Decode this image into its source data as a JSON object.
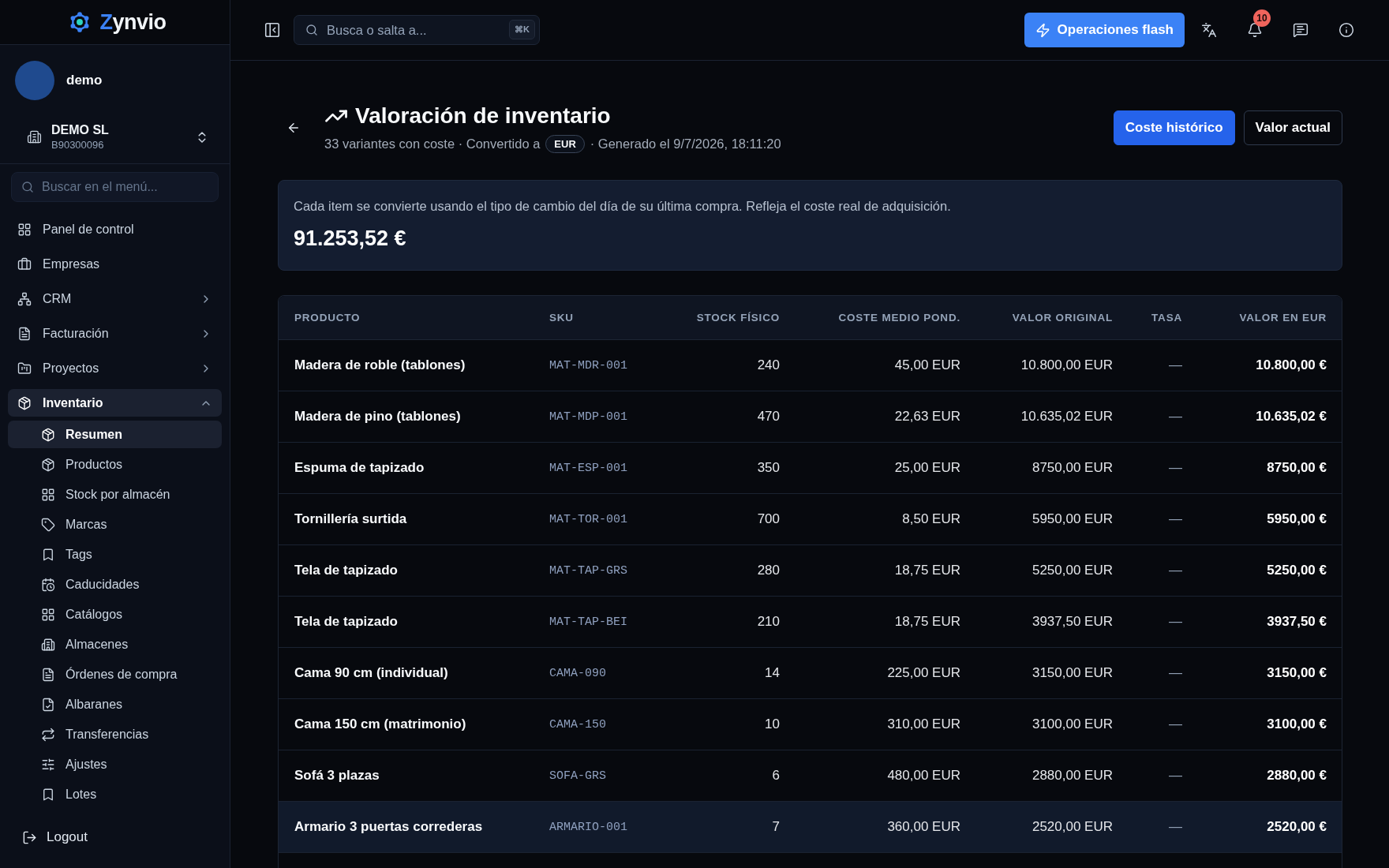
{
  "sidebar": {
    "logo": {
      "accent": "Z",
      "rest": "ynvio"
    },
    "user": {
      "name": "demo"
    },
    "company": {
      "name": "DEMO SL",
      "tax_id": "B90300096"
    },
    "search": {
      "placeholder": "Buscar en el menú..."
    },
    "items": [
      {
        "label": "Panel de control",
        "kind": "link",
        "selected": false
      },
      {
        "label": "Empresas",
        "kind": "link",
        "selected": false
      },
      {
        "label": "CRM",
        "kind": "group",
        "selected": false,
        "expanded": false
      },
      {
        "label": "Facturación",
        "kind": "group",
        "selected": false,
        "expanded": false
      },
      {
        "label": "Proyectos",
        "kind": "group",
        "selected": false,
        "expanded": false
      },
      {
        "label": "Inventario",
        "kind": "group",
        "selected": true,
        "expanded": true,
        "children": [
          {
            "label": "Resumen",
            "selected": true
          },
          {
            "label": "Productos",
            "selected": false
          },
          {
            "label": "Stock por almacén",
            "selected": false
          },
          {
            "label": "Marcas",
            "selected": false
          },
          {
            "label": "Tags",
            "selected": false
          },
          {
            "label": "Caducidades",
            "selected": false
          },
          {
            "label": "Catálogos",
            "selected": false
          },
          {
            "label": "Almacenes",
            "selected": false
          },
          {
            "label": "Órdenes de compra",
            "selected": false
          },
          {
            "label": "Albaranes",
            "selected": false
          },
          {
            "label": "Transferencias",
            "selected": false
          },
          {
            "label": "Ajustes",
            "selected": false
          },
          {
            "label": "Lotes",
            "selected": false
          }
        ]
      }
    ],
    "logout": {
      "label": "Logout"
    }
  },
  "topbar": {
    "search": {
      "placeholder": "Busca o salta a...",
      "shortcut": "⌘K"
    },
    "flash_button": {
      "label": "Operaciones flash"
    },
    "notifications": {
      "count": "10"
    }
  },
  "page": {
    "title": "Valoración de inventario",
    "subtitle": {
      "before_badge": "33 variantes con coste · Convertido a",
      "badge": "EUR",
      "after_badge": "· Generado el 9/7/2026, 18:11:20"
    },
    "views": [
      {
        "label": "Coste histórico",
        "selected": true
      },
      {
        "label": "Valor actual",
        "selected": false
      }
    ]
  },
  "summary": {
    "note": "Cada item se convierte usando el tipo de cambio del día de su última compra. Refleja el coste real de adquisición.",
    "total": "91.253,52 €"
  },
  "table": {
    "columns": [
      "PRODUCTO",
      "SKU",
      "STOCK FÍSICO",
      "COSTE MEDIO POND.",
      "VALOR ORIGINAL",
      "TASA",
      "VALOR EN EUR"
    ],
    "rows": [
      {
        "cells": [
          "Madera de roble (tablones)",
          "MAT-MDR-001",
          "240",
          "45,00 EUR",
          "10.800,00 EUR",
          "—",
          "10.800,00 €"
        ],
        "highlighted": false
      },
      {
        "cells": [
          "Madera de pino (tablones)",
          "MAT-MDP-001",
          "470",
          "22,63 EUR",
          "10.635,02 EUR",
          "—",
          "10.635,02 €"
        ],
        "highlighted": false
      },
      {
        "cells": [
          "Espuma de tapizado",
          "MAT-ESP-001",
          "350",
          "25,00 EUR",
          "8750,00 EUR",
          "—",
          "8750,00 €"
        ],
        "highlighted": false
      },
      {
        "cells": [
          "Tornillería surtida",
          "MAT-TOR-001",
          "700",
          "8,50 EUR",
          "5950,00 EUR",
          "—",
          "5950,00 €"
        ],
        "highlighted": false
      },
      {
        "cells": [
          "Tela de tapizado",
          "MAT-TAP-GRS",
          "280",
          "18,75 EUR",
          "5250,00 EUR",
          "—",
          "5250,00 €"
        ],
        "highlighted": false
      },
      {
        "cells": [
          "Tela de tapizado",
          "MAT-TAP-BEI",
          "210",
          "18,75 EUR",
          "3937,50 EUR",
          "—",
          "3937,50 €"
        ],
        "highlighted": false
      },
      {
        "cells": [
          "Cama 90 cm (individual)",
          "CAMA-090",
          "14",
          "225,00 EUR",
          "3150,00 EUR",
          "—",
          "3150,00 €"
        ],
        "highlighted": false
      },
      {
        "cells": [
          "Cama 150 cm (matrimonio)",
          "CAMA-150",
          "10",
          "310,00 EUR",
          "3100,00 EUR",
          "—",
          "3100,00 €"
        ],
        "highlighted": false
      },
      {
        "cells": [
          "Sofá 3 plazas",
          "SOFA-GRS",
          "6",
          "480,00 EUR",
          "2880,00 EUR",
          "—",
          "2880,00 €"
        ],
        "highlighted": false
      },
      {
        "cells": [
          "Armario 3 puertas correderas",
          "ARMARIO-001",
          "7",
          "360,00 EUR",
          "2520,00 EUR",
          "—",
          "2520,00 €"
        ],
        "highlighted": true
      }
    ]
  }
}
